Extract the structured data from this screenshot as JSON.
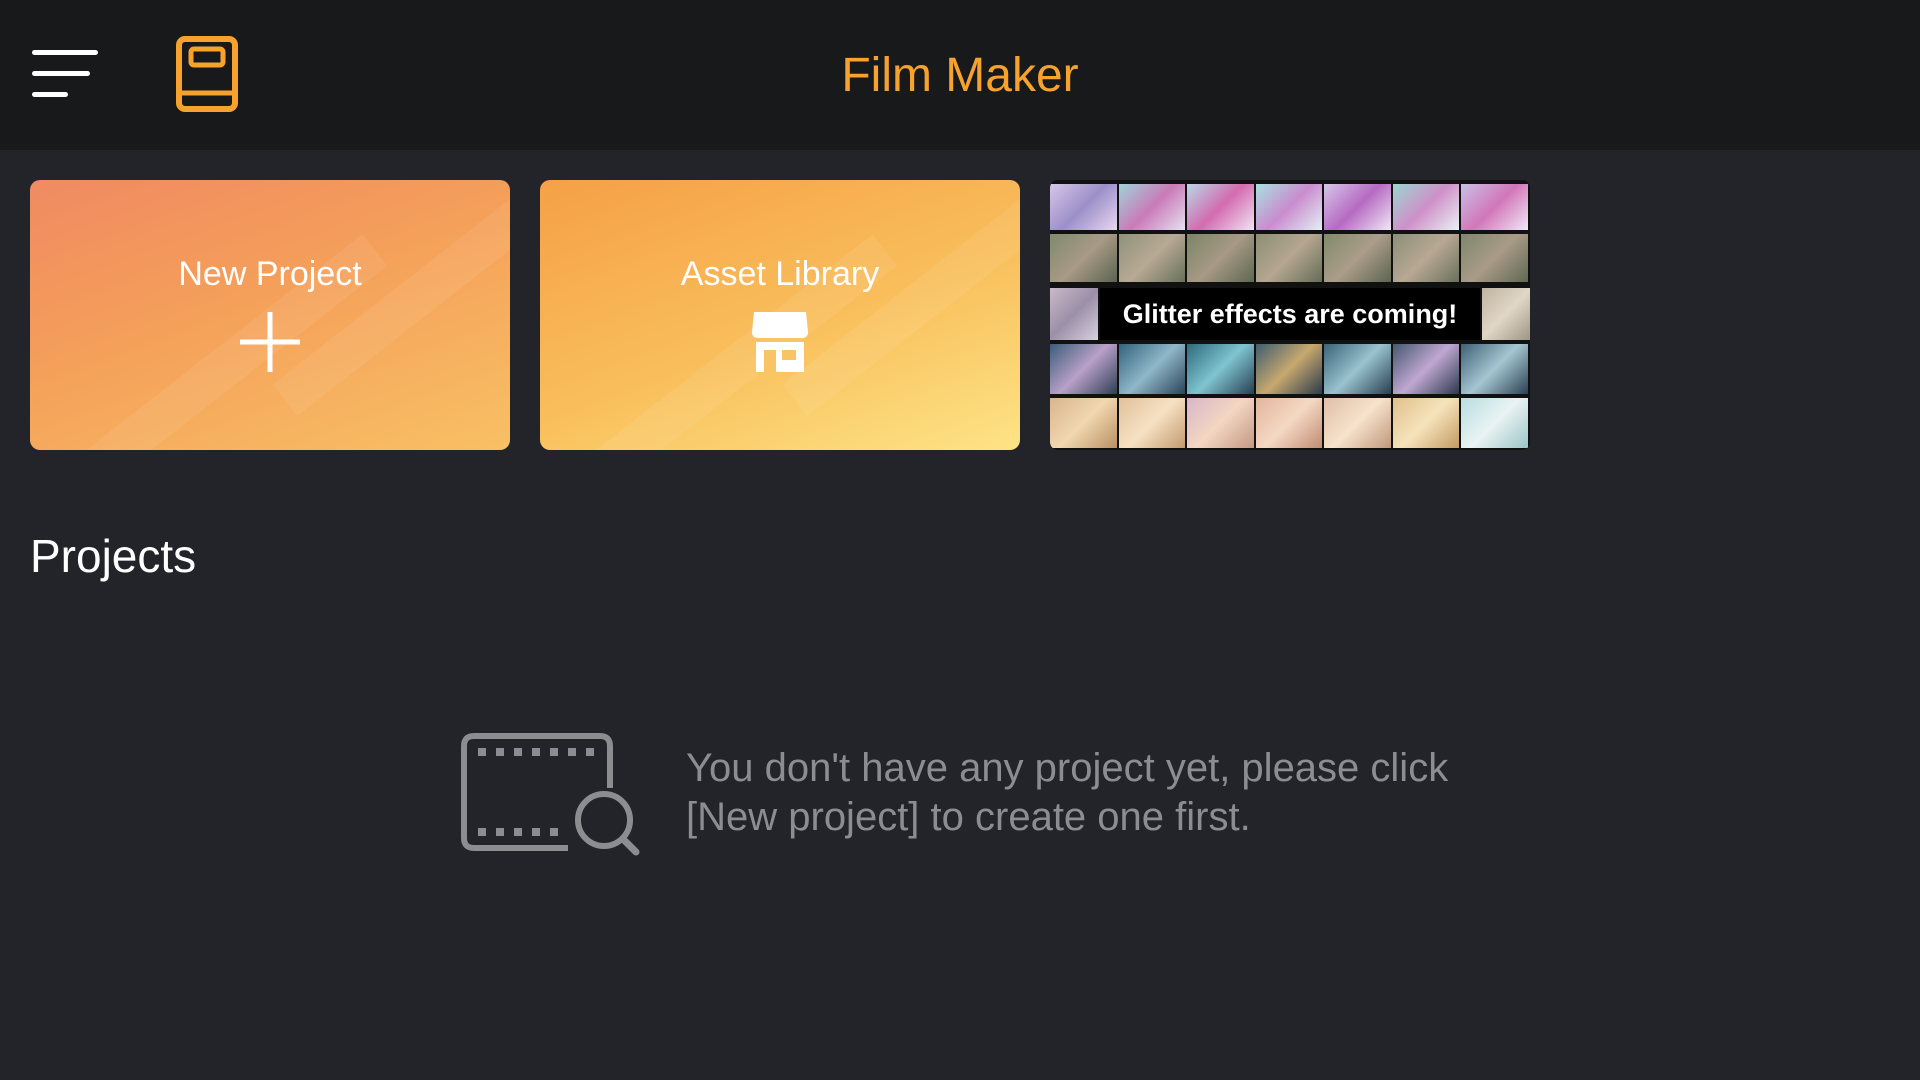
{
  "header": {
    "title": "Film Maker",
    "menu_icon": "hamburger-menu-icon",
    "guide_icon": "book-icon"
  },
  "cards": {
    "new_project": {
      "label": "New Project",
      "icon": "plus-icon"
    },
    "asset_library": {
      "label": "Asset Library",
      "icon": "store-icon"
    }
  },
  "banner": {
    "caption": "Glitter effects are coming!"
  },
  "projects": {
    "heading": "Projects",
    "empty_icon": "video-search-icon",
    "empty_line1": "You don't have any project yet, please click",
    "empty_line2": "[New project] to create one first."
  },
  "colors": {
    "accent": "#f7a22c",
    "background": "#232429",
    "topbar": "#18191b"
  }
}
